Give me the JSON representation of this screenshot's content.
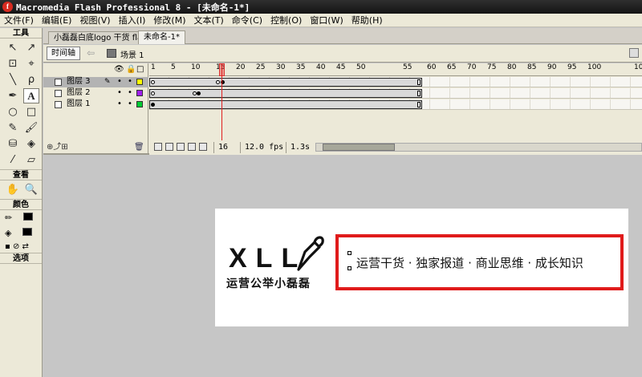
{
  "window": {
    "title": "Macromedia Flash Professional 8 - [未命名-1*]",
    "icon": "flash-app-icon"
  },
  "menu": [
    "文件(F)",
    "编辑(E)",
    "视图(V)",
    "插入(I)",
    "修改(M)",
    "文本(T)",
    "命令(C)",
    "控制(O)",
    "窗口(W)",
    "帮助(H)"
  ],
  "tools": {
    "title": "工具",
    "view_title": "查看",
    "colors_title": "颜色",
    "options_title": "选项",
    "items": [
      "arrow-icon",
      "subselect-icon",
      "free-transform-icon",
      "lasso-icon",
      "line-icon",
      "lasso2-icon",
      "pen-icon",
      "text-icon",
      "oval-icon",
      "rect-icon",
      "pencil-icon",
      "brush-icon",
      "ink-bottle-icon",
      "paint-bucket-icon",
      "eyedropper-icon",
      "eraser-icon"
    ],
    "active": "text-icon"
  },
  "doc_tabs": [
    "小磊磊白底logo 干货 fla*",
    "未命名-1*"
  ],
  "scene_bar": {
    "timeline_button": "时间轴",
    "scene_label": "场景 1"
  },
  "timeline": {
    "ruler_ticks": [
      "1",
      "5",
      "10",
      "15",
      "20",
      "25",
      "30",
      "35",
      "40",
      "45",
      "50",
      "55",
      "60",
      "65",
      "70",
      "75",
      "80",
      "85",
      "90",
      "95",
      "100",
      "10"
    ],
    "layers": [
      {
        "name": "图层 3",
        "color": "#ffff00",
        "selected": true
      },
      {
        "name": "图层 2",
        "color": "#a020f0",
        "selected": false
      },
      {
        "name": "图层 1",
        "color": "#00cc33",
        "selected": false
      }
    ],
    "current_frame": "16",
    "fps": "12.0 fps",
    "time": "1.3s"
  },
  "stage": {
    "logo_text": "XLL",
    "logo_subtitle": "运营公举小磊磊",
    "slogan": "运营干货 · 独家报道 · 商业思维 · 成长知识",
    "highlight_color": "#e01b1b"
  }
}
